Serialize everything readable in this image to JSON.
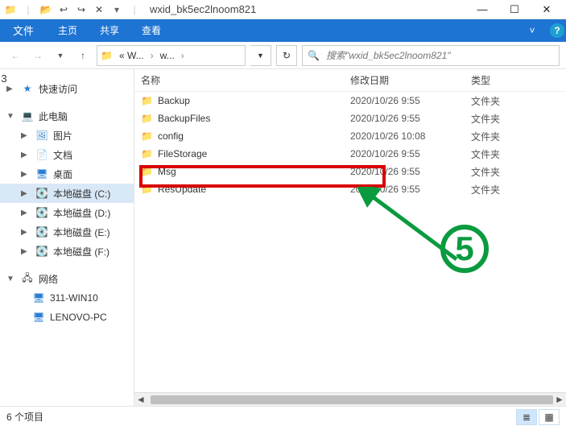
{
  "title": "wxid_bk5ec2lnoom821",
  "ribbon": {
    "file": "文件",
    "home": "主页",
    "share": "共享",
    "view": "查看"
  },
  "address": {
    "crumb1": "« W...",
    "crumb2": "w...",
    "search_placeholder": "搜索\"wxid_bk5ec2lnoom821\""
  },
  "sidebar": {
    "quick": "快速访问",
    "pc": "此电脑",
    "pictures": "图片",
    "documents": "文档",
    "desktop": "桌面",
    "drive_c": "本地磁盘 (C:)",
    "drive_d": "本地磁盘 (D:)",
    "drive_e": "本地磁盘 (E:)",
    "drive_f": "本地磁盘 (F:)",
    "network": "网络",
    "net1": "311-WIN10",
    "net2": "LENOVO-PC"
  },
  "columns": {
    "name": "名称",
    "date": "修改日期",
    "type": "类型"
  },
  "rows": [
    {
      "name": "Backup",
      "date": "2020/10/26 9:55",
      "type": "文件夹"
    },
    {
      "name": "BackupFiles",
      "date": "2020/10/26 9:55",
      "type": "文件夹"
    },
    {
      "name": "config",
      "date": "2020/10/26 10:08",
      "type": "文件夹"
    },
    {
      "name": "FileStorage",
      "date": "2020/10/26 9:55",
      "type": "文件夹"
    },
    {
      "name": "Msg",
      "date": "2020/10/26 9:55",
      "type": "文件夹"
    },
    {
      "name": "ResUpdate",
      "date": "2020/10/26 9:55",
      "type": "文件夹"
    }
  ],
  "status": {
    "count": "6 个项目"
  },
  "annotation": {
    "step": "5"
  },
  "side_marker": "3"
}
